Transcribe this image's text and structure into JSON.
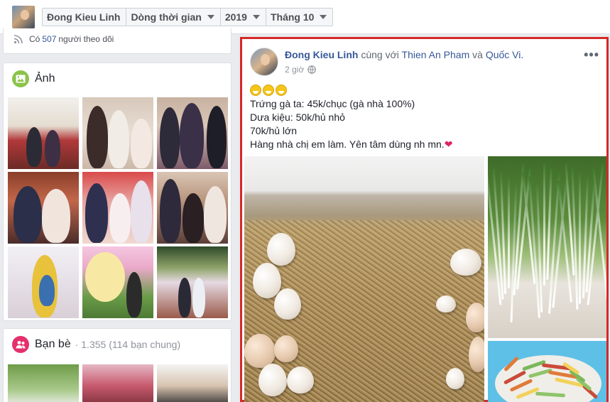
{
  "topbar": {
    "crumbs": [
      {
        "label": "Đong Kieu Linh"
      },
      {
        "label": "Dòng thời gian"
      },
      {
        "label": "2019"
      },
      {
        "label": "Tháng 10"
      }
    ]
  },
  "follow": {
    "prefix": "Có",
    "count": "507",
    "suffix": "người theo dõi"
  },
  "photos": {
    "title": "Ảnh"
  },
  "friends": {
    "title": "Bạn bè",
    "count": "· 1.355 (114 bạn chung)"
  },
  "post": {
    "author": "Đong Kieu Linh",
    "with_text": "cùng với",
    "tagged_1": "Thien An Pham",
    "and_text": "và",
    "tagged_2": "Quốc Vi.",
    "time": "2 giờ",
    "lines": [
      "Trứng gà ta: 45k/chục (gà nhà 100%)",
      "Dưa kiệu: 50k/hủ nhỏ",
      "70k/hủ lớn",
      "Hàng nhà chị em làm. Yên tâm dùng nh mn."
    ],
    "heart": "❤",
    "more": "•••"
  },
  "colors": {
    "link": "#365899",
    "highlight_border": "#d62828",
    "photos_icon_bg": "#8bc34a",
    "friends_icon_bg": "#e4306c"
  },
  "icons": [
    "rss-icon",
    "photo-icon",
    "friends-icon",
    "globe-icon",
    "more-icon",
    "grin-emoji-icon",
    "heart-icon",
    "caret-down-icon"
  ]
}
